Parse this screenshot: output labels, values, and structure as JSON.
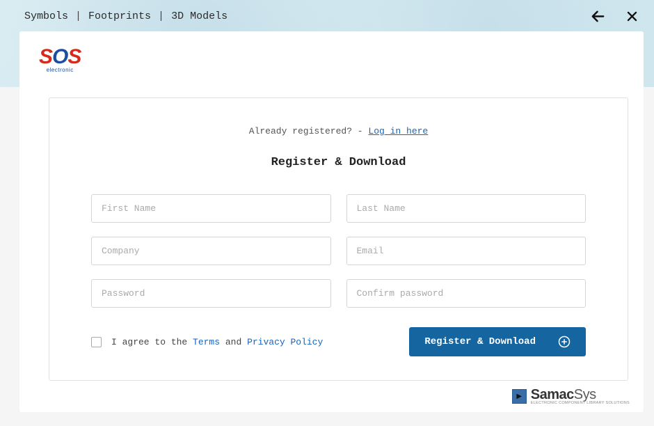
{
  "header": {
    "breadcrumb": {
      "item1": "Symbols",
      "item2": "Footprints",
      "item3": "3D Models"
    }
  },
  "logo": {
    "brand_s1": "S",
    "brand_o": "O",
    "brand_s2": "S",
    "tagline": "electronic"
  },
  "form": {
    "already_text": "Already registered? - ",
    "login_link": "Log in here",
    "title": "Register & Download",
    "placeholders": {
      "first_name": "First Name",
      "last_name": "Last Name",
      "company": "Company",
      "email": "Email",
      "password": "Password",
      "confirm_password": "Confirm password"
    },
    "terms": {
      "prefix": "I agree to the ",
      "terms_link": "Terms",
      "and": " and ",
      "privacy_link": "Privacy Policy"
    },
    "submit_label": "Register & Download"
  },
  "footer": {
    "brand_prefix": "Samac",
    "brand_suffix": "Sys",
    "tagline": "ELECTRONIC COMPONENT LIBRARY SOLUTIONS"
  }
}
